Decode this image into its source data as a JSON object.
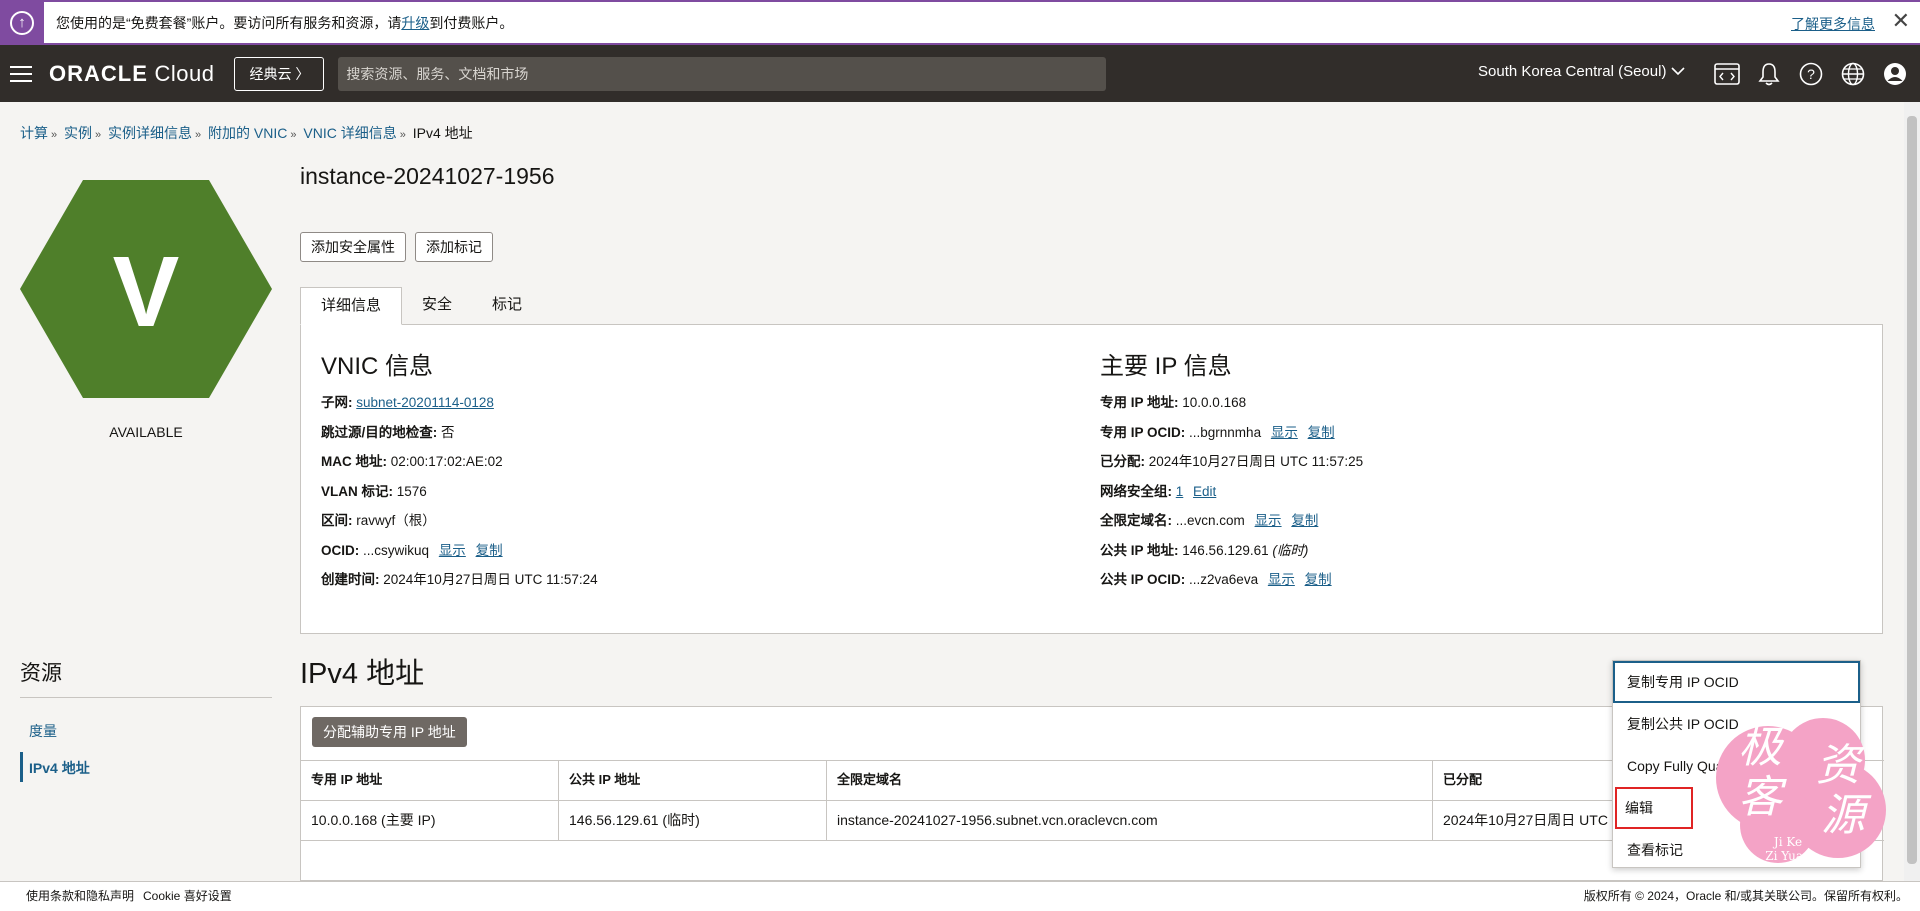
{
  "banner": {
    "text_before": "您使用的是“免费套餐”账户。要访问所有服务和资源，请",
    "upgrade_link": "升级",
    "text_after": "到付费账户。",
    "learn_more": "了解更多信息",
    "close": "✕"
  },
  "header": {
    "logo_bold": "ORACLE",
    "logo_rest": " Cloud",
    "classic_button": "经典云 〉",
    "search_placeholder": "搜索资源、服务、文档和市场",
    "region": "South Korea Central (Seoul)",
    "icons": [
      "code-editor-icon",
      "bell-icon",
      "help-icon",
      "globe-icon",
      "user-icon"
    ]
  },
  "breadcrumb": [
    "计算",
    "实例",
    "实例详细信息",
    "附加的 VNIC",
    "VNIC 详细信息",
    "IPv4 地址"
  ],
  "hex": {
    "letter": "V",
    "status": "AVAILABLE",
    "color": "#4f7f2a"
  },
  "page": {
    "title": "instance-20241027-1956",
    "buttons": [
      "添加安全属性",
      "添加标记"
    ],
    "tabs": [
      "详细信息",
      "安全",
      "标记"
    ]
  },
  "vnic": {
    "heading": "VNIC 信息",
    "subnet_label": "子网:",
    "subnet_value": "subnet-20201114-0128",
    "skip_label": "跳过源/目的地检查:",
    "skip_value": "否",
    "mac_label": "MAC 地址:",
    "mac_value": "02:00:17:02:AE:02",
    "vlan_label": "VLAN 标记:",
    "vlan_value": "1576",
    "compartment_label": "区间:",
    "compartment_value": "ravwyf（根）",
    "ocid_label": "OCID:",
    "ocid_value": "...csywikuq",
    "show": "显示",
    "copy": "复制",
    "created_label": "创建时间:",
    "created_value": "2024年10月27日周日 UTC 11:57:24"
  },
  "primary_ip": {
    "heading": "主要 IP 信息",
    "private_ip_label": "专用 IP 地址:",
    "private_ip_value": "10.0.0.168",
    "private_ocid_label": "专用 IP OCID:",
    "private_ocid_value": "...bgrnnmha",
    "assigned_label": "已分配:",
    "assigned_value": "2024年10月27日周日 UTC 11:57:25",
    "nsg_label": "网络安全组:",
    "nsg_value": "1",
    "nsg_edit": "Edit",
    "fqdn_label": "全限定域名:",
    "fqdn_value": "...evcn.com",
    "public_ip_label": "公共 IP 地址:",
    "public_ip_value": "146.56.129.61",
    "public_ip_note": "(临时)",
    "public_ocid_label": "公共 IP OCID:",
    "public_ocid_value": "...z2va6eva",
    "show": "显示",
    "copy": "复制"
  },
  "resources": {
    "title": "资源",
    "items": [
      "度量",
      "IPv4 地址"
    ]
  },
  "ipv4": {
    "title": "IPv4 地址",
    "assign_button": "分配辅助专用 IP 地址",
    "columns": [
      "专用 IP 地址",
      "公共 IP 地址",
      "全限定域名",
      "已分配"
    ],
    "rows": [
      [
        "10.0.0.168 (主要 IP)",
        "146.56.129.61 (临时)",
        "instance-20241027-1956.subnet.vcn.oraclevcn.com",
        "2024年10月27日周日 UTC 1"
      ]
    ]
  },
  "menu": {
    "items": [
      "复制专用 IP OCID",
      "复制公共 IP OCID",
      "Copy Fully Qualified Domain Name",
      "编辑",
      "查看标记"
    ]
  },
  "watermark": {
    "chars": [
      "极",
      "客",
      "资",
      "源"
    ],
    "latin1": "Ji Ke",
    "latin2": "Zi Yuan",
    "color": "#f4a3c6"
  },
  "footer": {
    "terms": "使用条款和隐私声明",
    "cookie": "Cookie 喜好设置",
    "copyright": "版权所有 © 2024，Oracle 和/或其关联公司。保留所有权利。"
  }
}
